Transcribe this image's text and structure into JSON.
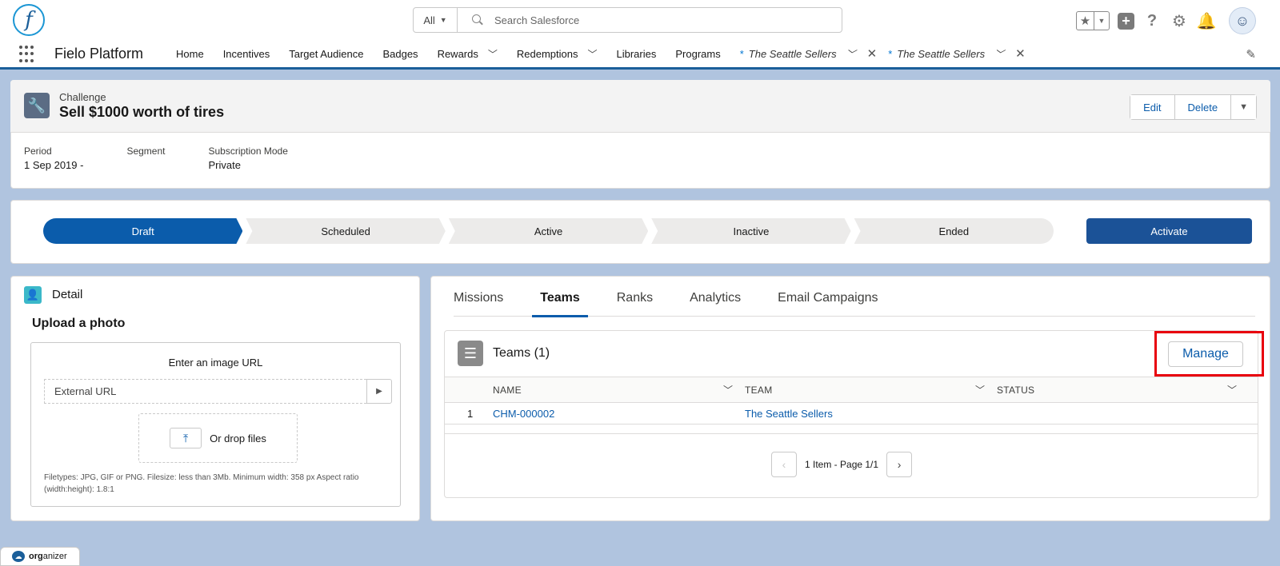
{
  "header": {
    "logo_letter": "f",
    "search_scope": "All",
    "search_placeholder": "Search Salesforce",
    "icons": [
      "star-icon",
      "chevron-down-icon",
      "plus-icon",
      "help-icon",
      "gear-icon",
      "bell-icon",
      "avatar"
    ]
  },
  "nav": {
    "app_name": "Fielo Platform",
    "items": [
      {
        "label": "Home",
        "has_menu": false
      },
      {
        "label": "Incentives",
        "has_menu": false
      },
      {
        "label": "Target Audience",
        "has_menu": false
      },
      {
        "label": "Badges",
        "has_menu": false
      },
      {
        "label": "Rewards",
        "has_menu": true
      },
      {
        "label": "Redemptions",
        "has_menu": true
      },
      {
        "label": "Libraries",
        "has_menu": false
      },
      {
        "label": "Programs",
        "has_menu": false
      }
    ],
    "open_tabs": [
      {
        "marker": "*",
        "label": "The Seattle Sellers"
      },
      {
        "marker": "*",
        "label": "The Seattle Sellers"
      }
    ]
  },
  "record": {
    "object_type": "Challenge",
    "title": "Sell $1000 worth of tires",
    "actions": {
      "edit": "Edit",
      "delete": "Delete"
    },
    "fields": [
      {
        "label": "Period",
        "value": "1 Sep 2019 -"
      },
      {
        "label": "Segment",
        "value": ""
      },
      {
        "label": "Subscription Mode",
        "value": "Private"
      }
    ]
  },
  "path": {
    "stages": [
      "Draft",
      "Scheduled",
      "Active",
      "Inactive",
      "Ended"
    ],
    "current": "Draft",
    "action_label": "Activate"
  },
  "detail": {
    "title": "Detail",
    "upload_heading": "Upload a photo",
    "url_label": "Enter an image URL",
    "url_placeholder": "External URL",
    "drop_text": "Or drop files",
    "filetypes": "Filetypes: JPG, GIF or PNG. Filesize: less than 3Mb. Minimum width: 358 px Aspect ratio (width:height): 1.8:1"
  },
  "tabs": {
    "items": [
      "Missions",
      "Teams",
      "Ranks",
      "Analytics",
      "Email Campaigns"
    ],
    "active": "Teams"
  },
  "related": {
    "title": "Teams (1)",
    "manage_label": "Manage",
    "columns": [
      "NAME",
      "TEAM",
      "STATUS"
    ],
    "rows": [
      {
        "num": "1",
        "name": "CHM-000002",
        "team": "The Seattle Sellers",
        "status": ""
      }
    ],
    "pager_text": "1 Item - Page 1/1"
  },
  "utility": {
    "label_bold": "org",
    "label_rest": "anizer"
  },
  "colors": {
    "brand": "#0b5cab",
    "path_current": "#0b5cab",
    "activate_button": "#1b5297",
    "highlight_box": "#e8000d",
    "background": "#b0c4df"
  }
}
